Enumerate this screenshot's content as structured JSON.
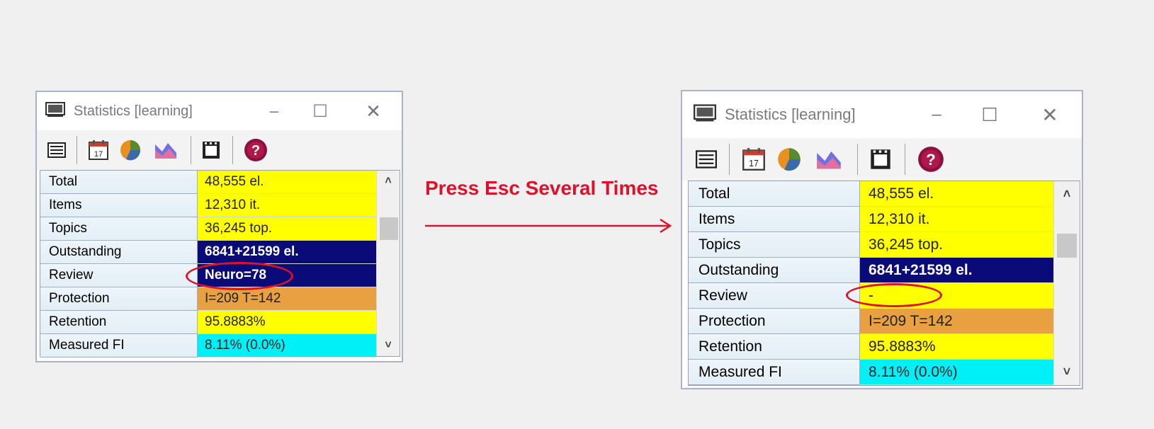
{
  "annotation": {
    "text": "Press Esc Several Times",
    "color": "#e0102a"
  },
  "colors": {
    "yellow": "#ffff00",
    "navy": "#0a0a78",
    "orange": "#e8a040",
    "cyan": "#00f0f8",
    "highlight": "#e0102a"
  },
  "before": {
    "title": "Statistics [learning]",
    "title_controls": [
      "–",
      "☐",
      "✕"
    ],
    "toolbar": [
      "list-icon",
      "calendar-icon",
      "pie-chart-icon",
      "graph-icon",
      "film-icon",
      "help-icon"
    ],
    "calendar_day": "17",
    "rows": [
      {
        "label": "Total",
        "value": "48,555 el.",
        "color": "yellow"
      },
      {
        "label": "Items",
        "value": "12,310 it.",
        "color": "yellow"
      },
      {
        "label": "Topics",
        "value": "36,245 top.",
        "color": "yellow"
      },
      {
        "label": "Outstanding",
        "value": "6841+21599 el.",
        "color": "navy"
      },
      {
        "label": "Review",
        "value": "Neuro=78",
        "color": "navy"
      },
      {
        "label": "Protection",
        "value": "I=209 T=142",
        "color": "orange"
      },
      {
        "label": "Retention",
        "value": "95.8883%",
        "color": "yellow"
      },
      {
        "label": "Measured FI",
        "value": "8.11% (0.0%)",
        "color": "cyan"
      }
    ]
  },
  "after": {
    "title": "Statistics [learning]",
    "title_controls": [
      "–",
      "☐",
      "✕"
    ],
    "toolbar": [
      "list-icon",
      "calendar-icon",
      "pie-chart-icon",
      "graph-icon",
      "film-icon",
      "help-icon"
    ],
    "calendar_day": "17",
    "rows": [
      {
        "label": "Total",
        "value": "48,555 el.",
        "color": "yellow"
      },
      {
        "label": "Items",
        "value": "12,310 it.",
        "color": "yellow"
      },
      {
        "label": "Topics",
        "value": "36,245 top.",
        "color": "yellow"
      },
      {
        "label": "Outstanding",
        "value": "6841+21599 el.",
        "color": "navy"
      },
      {
        "label": "Review",
        "value": "-",
        "color": "yellow"
      },
      {
        "label": "Protection",
        "value": "I=209 T=142",
        "color": "orange"
      },
      {
        "label": "Retention",
        "value": "95.8883%",
        "color": "yellow"
      },
      {
        "label": "Measured FI",
        "value": "8.11% (0.0%)",
        "color": "cyan"
      }
    ]
  }
}
